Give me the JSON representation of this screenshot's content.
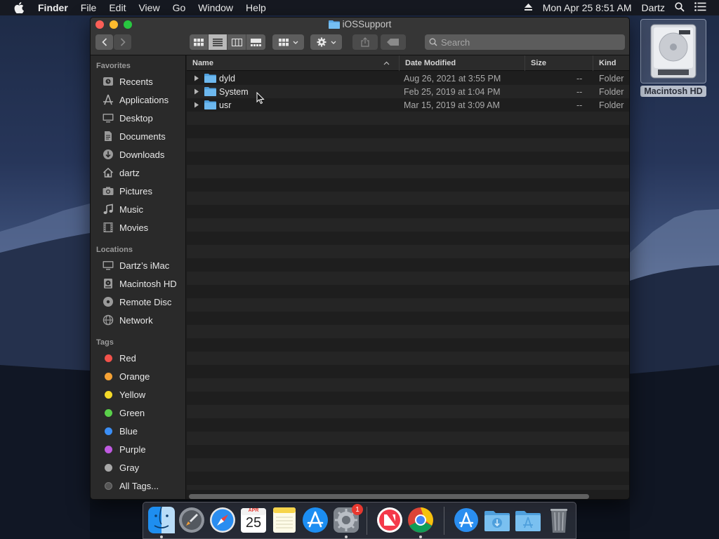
{
  "menubar": {
    "app_name": "Finder",
    "menus": [
      "File",
      "Edit",
      "View",
      "Go",
      "Window",
      "Help"
    ],
    "clock": "Mon Apr 25  8:51 AM",
    "user": "Dartz"
  },
  "desktop": {
    "disk_label": "Macintosh HD"
  },
  "window": {
    "title": "iOSSupport",
    "search_placeholder": "Search"
  },
  "sidebar": {
    "favorites_header": "Favorites",
    "favorites": [
      {
        "label": "Recents",
        "icon": "clock-icon"
      },
      {
        "label": "Applications",
        "icon": "applications-icon"
      },
      {
        "label": "Desktop",
        "icon": "desktop-icon"
      },
      {
        "label": "Documents",
        "icon": "document-icon"
      },
      {
        "label": "Downloads",
        "icon": "download-icon"
      },
      {
        "label": "dartz",
        "icon": "home-icon"
      },
      {
        "label": "Pictures",
        "icon": "camera-icon"
      },
      {
        "label": "Music",
        "icon": "music-note-icon"
      },
      {
        "label": "Movies",
        "icon": "film-icon"
      }
    ],
    "locations_header": "Locations",
    "locations": [
      {
        "label": "Dartz’s iMac",
        "icon": "imac-icon"
      },
      {
        "label": "Macintosh HD",
        "icon": "hard-drive-icon"
      },
      {
        "label": "Remote Disc",
        "icon": "disc-icon"
      },
      {
        "label": "Network",
        "icon": "globe-icon"
      }
    ],
    "tags_header": "Tags",
    "tags": [
      {
        "label": "Red",
        "color": "#f2524b"
      },
      {
        "label": "Orange",
        "color": "#f5a235"
      },
      {
        "label": "Yellow",
        "color": "#f4d928"
      },
      {
        "label": "Green",
        "color": "#5ad04a"
      },
      {
        "label": "Blue",
        "color": "#3b8ef5"
      },
      {
        "label": "Purple",
        "color": "#bf5ae0"
      },
      {
        "label": "Gray",
        "color": "#a8a8a8"
      },
      {
        "label": "All Tags...",
        "color": "#555555"
      }
    ]
  },
  "columns": {
    "name": "Name",
    "date": "Date Modified",
    "size": "Size",
    "kind": "Kind"
  },
  "files": [
    {
      "name": "dyld",
      "date": "Aug 26, 2021 at 3:55 PM",
      "size": "--",
      "kind": "Folder"
    },
    {
      "name": "System",
      "date": "Feb 25, 2019 at 1:04 PM",
      "size": "--",
      "kind": "Folder"
    },
    {
      "name": "usr",
      "date": "Mar 15, 2019 at 3:09 AM",
      "size": "--",
      "kind": "Folder"
    }
  ],
  "dock": {
    "calendar_month": "APR",
    "calendar_day": "25",
    "system_preferences_badge": "1",
    "apps": [
      "finder-icon",
      "launchpad-icon",
      "safari-icon",
      "calendar-icon",
      "notes-icon",
      "app-store-icon",
      "system-preferences-icon",
      "news-icon",
      "chrome-icon",
      "applications-folder-icon",
      "downloads-folder-icon",
      "applications-stack-icon",
      "trash-icon"
    ]
  }
}
